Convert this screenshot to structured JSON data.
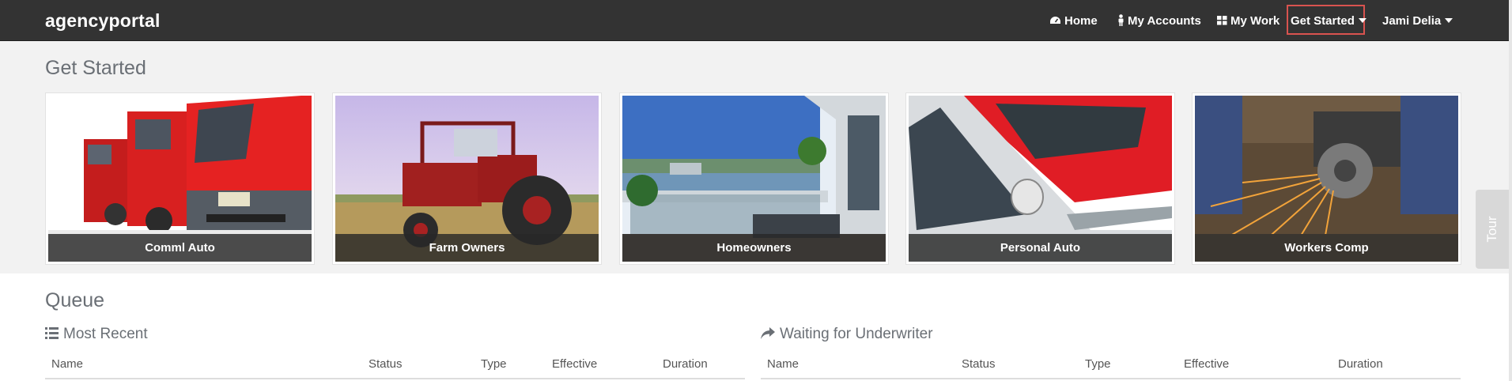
{
  "app": {
    "brand": "agencyportal"
  },
  "nav": {
    "home": "Home",
    "my_accounts": "My Accounts",
    "my_work": "My Work",
    "get_started": "Get Started",
    "user": "Jami Delia"
  },
  "get_started": {
    "title": "Get Started",
    "cards": [
      {
        "label": "Comml Auto"
      },
      {
        "label": "Farm Owners"
      },
      {
        "label": "Homeowners"
      },
      {
        "label": "Personal Auto"
      },
      {
        "label": "Workers Comp"
      }
    ]
  },
  "tour": {
    "label": "Tour"
  },
  "queue": {
    "title": "Queue",
    "most_recent": {
      "title": "Most Recent",
      "columns": [
        "Name",
        "Status",
        "Type",
        "Effective",
        "Duration"
      ]
    },
    "waiting": {
      "title": "Waiting for Underwriter",
      "columns": [
        "Name",
        "Status",
        "Type",
        "Effective",
        "Duration"
      ]
    }
  },
  "colors": {
    "navbar": "#333333",
    "active_outline": "#d9534f",
    "section_bg": "#f2f2f2"
  }
}
